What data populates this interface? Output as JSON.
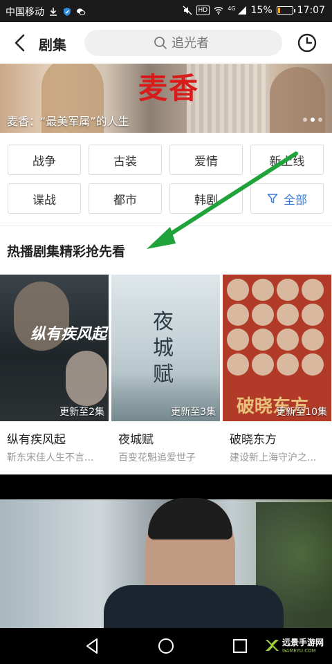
{
  "status_bar": {
    "carrier": "中国移动",
    "network": "4G",
    "hd_badge": "HD",
    "battery_text": "15%",
    "battery_level": 0.15,
    "time": "17:07"
  },
  "header": {
    "title": "剧集",
    "search_placeholder": "追光者"
  },
  "banner": {
    "title": "麦香",
    "caption": "麦香：“最美军属”的人生",
    "page_count": 3,
    "active_page": 2
  },
  "categories": [
    {
      "label": "战争"
    },
    {
      "label": "古装"
    },
    {
      "label": "爱情"
    },
    {
      "label": "新上线"
    },
    {
      "label": "谍战"
    },
    {
      "label": "都市"
    },
    {
      "label": "韩剧"
    },
    {
      "label": "全部"
    }
  ],
  "section": {
    "title": "热播剧集精彩抢先看",
    "items": [
      {
        "poster_text": "纵有疾风起",
        "update": "更新至2集",
        "title": "纵有疾风起",
        "subtitle": "靳东宋佳人生不言..."
      },
      {
        "poster_text": "夜城赋",
        "update": "更新至3集",
        "title": "夜城赋",
        "subtitle": "百变花魁追爱世子"
      },
      {
        "poster_text": "破晓东方",
        "update": "更新至10集",
        "title": "破晓东方",
        "subtitle": "建设新上海守沪之..."
      }
    ]
  },
  "watermark": {
    "name": "远景手游网",
    "url": "GAMEYU.COM"
  },
  "colors": {
    "accent_blue": "#3a7bd5",
    "annotation_green": "#1fa33a",
    "banner_title_red": "#d81c1c"
  }
}
